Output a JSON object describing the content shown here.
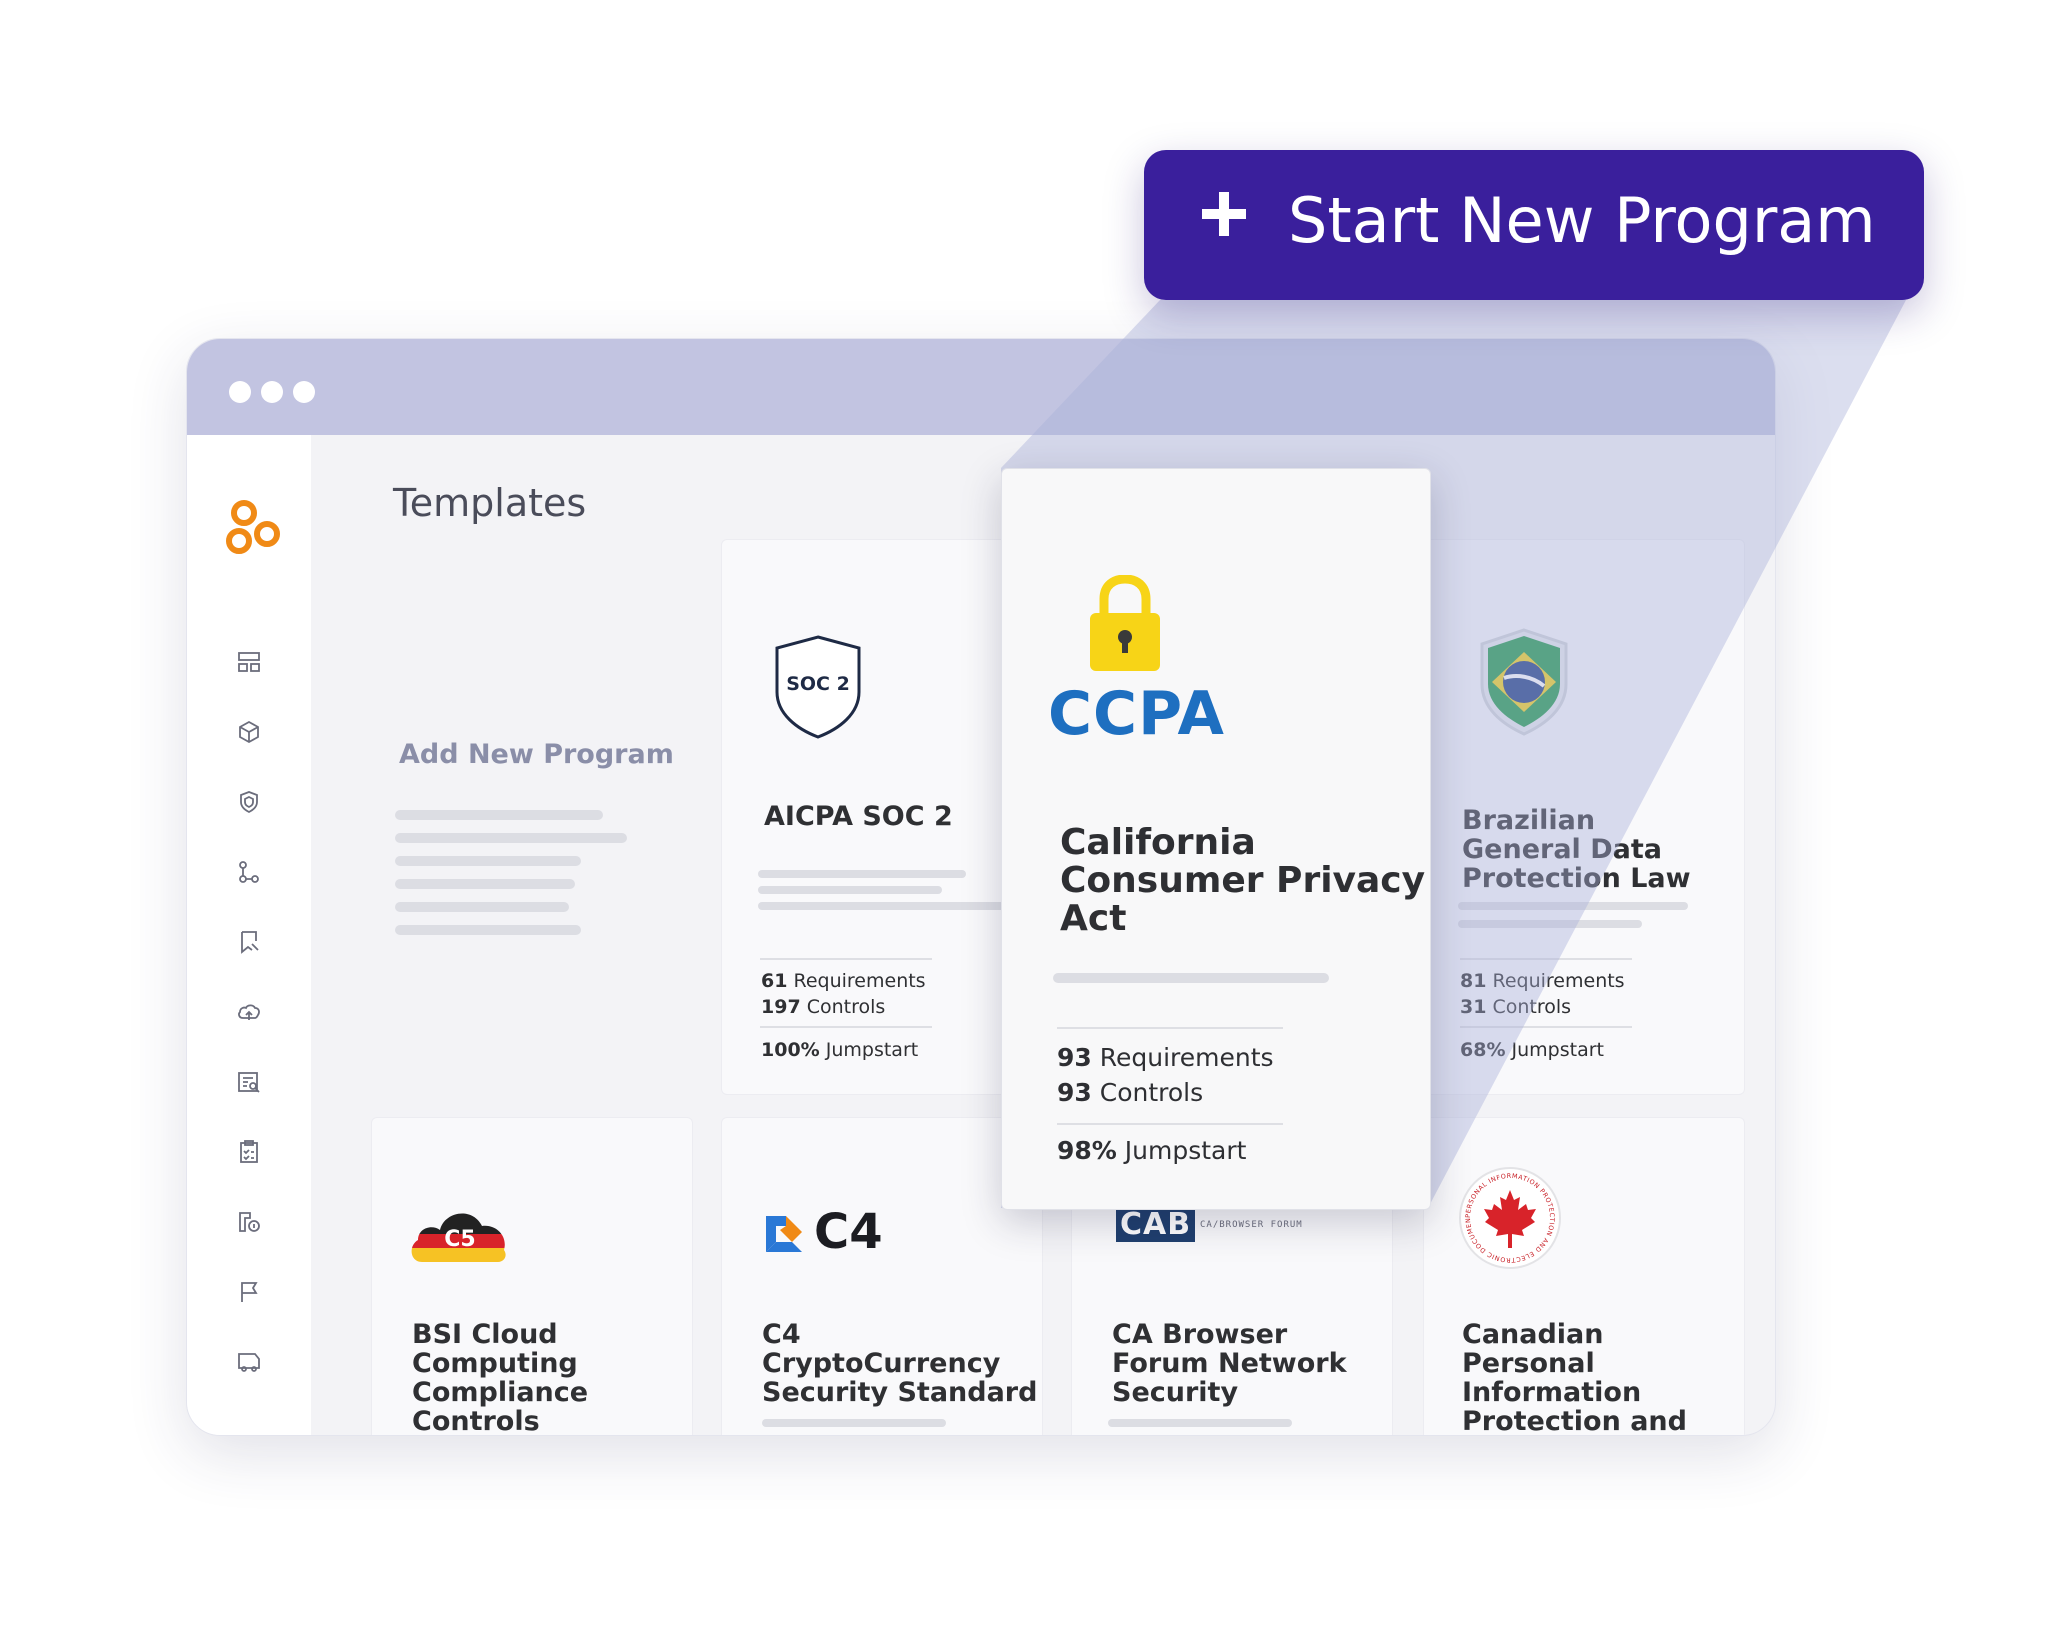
{
  "cta": {
    "label": "Start New Program"
  },
  "page": {
    "title": "Templates"
  },
  "add_card": {
    "label": "Add New Program"
  },
  "sidebar_icons": [
    "dashboard-icon",
    "cube-icon",
    "shield-icon",
    "workflow-icon",
    "bookmark-icon",
    "cloud-upload-icon",
    "report-search-icon",
    "clipboard-check-icon",
    "vendor-icon",
    "flag-icon",
    "truck-icon"
  ],
  "featured": {
    "logo_text": "CCPA",
    "title_lines": [
      "California",
      "Consumer Privacy",
      "Act"
    ],
    "requirements_count": "93",
    "requirements_label": " Requirements",
    "controls_count": "93",
    "controls_label": " Controls",
    "jumpstart_pct": "98%",
    "jumpstart_label": " Jumpstart"
  },
  "cards": {
    "soc2": {
      "badge": "SOC 2",
      "title": "AICPA SOC 2",
      "req": "61",
      "req_label": " Requirements",
      "ctl": "197",
      "ctl_label": " Controls",
      "jump": "100%",
      "jump_label": " Jumpstart"
    },
    "brazil": {
      "title_lines": [
        "Brazilian",
        "General Data",
        "Protection Law"
      ],
      "req": "81",
      "req_label": " Requirements",
      "ctl": "31",
      "ctl_label": " Controls",
      "jump": "68%",
      "jump_label": " Jumpstart"
    },
    "bsi": {
      "logo_text": "C5",
      "title_lines": [
        "BSI Cloud",
        "Computing",
        "Compliance",
        "Controls"
      ]
    },
    "c4": {
      "logo_text": "C4",
      "title_lines": [
        "C4",
        "CryptoCurrency",
        "Security Standard"
      ]
    },
    "cab": {
      "logo_text": "CAB",
      "logo_sub": "CA/BROWSER FORUM",
      "title_lines": [
        "CA Browser",
        "Forum Network",
        "Security"
      ]
    },
    "canada": {
      "seal_text": "PERSONAL INFORMATION PROTECTION AND ELECTRONIC DOCUMENTS",
      "title_lines": [
        "Canadian",
        "Personal",
        "Information",
        "Protection and"
      ]
    }
  },
  "colors": {
    "cta_bg": "#3a1f9c",
    "titlebar": "#c2c4e1",
    "ccpa_blue": "#1e6fc0",
    "lock_yellow": "#f7d417",
    "brand_orange": "#f08a16"
  }
}
